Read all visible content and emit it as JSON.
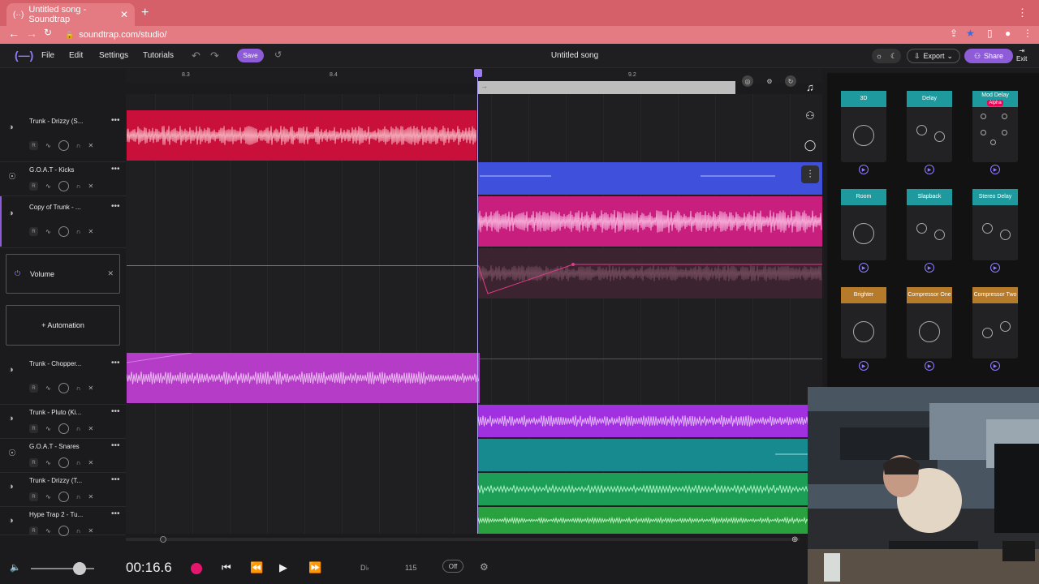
{
  "browser": {
    "tab_title": "Untitled song - Soundtrap",
    "url": "soundtrap.com/studio/"
  },
  "menu": {
    "file": "File",
    "edit": "Edit",
    "settings": "Settings",
    "tutorials": "Tutorials",
    "save": "Save"
  },
  "song_title": "Untitled song",
  "header": {
    "export": "Export",
    "share": "Share",
    "exit": "Exit"
  },
  "ruler": {
    "labels": [
      "8.3",
      "8.4",
      "9.2"
    ]
  },
  "tracks": [
    {
      "name": "Trunk - Drizzy (S...",
      "r": "R"
    },
    {
      "name": "G.O.A.T - Kicks",
      "r": "R"
    },
    {
      "name": "Copy of Trunk - ...",
      "r": "R"
    },
    {
      "name": "Trunk - Chopper...",
      "r": "R"
    },
    {
      "name": "Trunk - Pluto (Ki...",
      "r": "R"
    },
    {
      "name": "G.O.A.T - Snares",
      "r": "R"
    },
    {
      "name": "Trunk - Drizzy (T...",
      "r": "R"
    },
    {
      "name": "Hype Trap 2 - Tu...",
      "r": "R"
    }
  ],
  "automation": {
    "volume": "Volume",
    "add": "+ Automation"
  },
  "effects": [
    {
      "name": "3D",
      "color": "#1e9a9e"
    },
    {
      "name": "Delay",
      "color": "#1e9a9e"
    },
    {
      "name": "Mod Delay",
      "badge": "Alpha",
      "color": "#1e9a9e"
    },
    {
      "name": "Room",
      "color": "#1e9a9e"
    },
    {
      "name": "Slapback",
      "color": "#1e9a9e"
    },
    {
      "name": "Stereo Delay",
      "color": "#1e9a9e"
    },
    {
      "name": "Brighter",
      "color": "#b57a2a"
    },
    {
      "name": "Compressor One",
      "color": "#b57a2a"
    },
    {
      "name": "Compressor Two",
      "color": "#b57a2a"
    }
  ],
  "transport": {
    "time": "00:16.6",
    "key": "D♭",
    "tempo": "115",
    "metronome": "Off"
  },
  "colors": {
    "accent": "#8e5bd9",
    "record": "#e6156e"
  }
}
